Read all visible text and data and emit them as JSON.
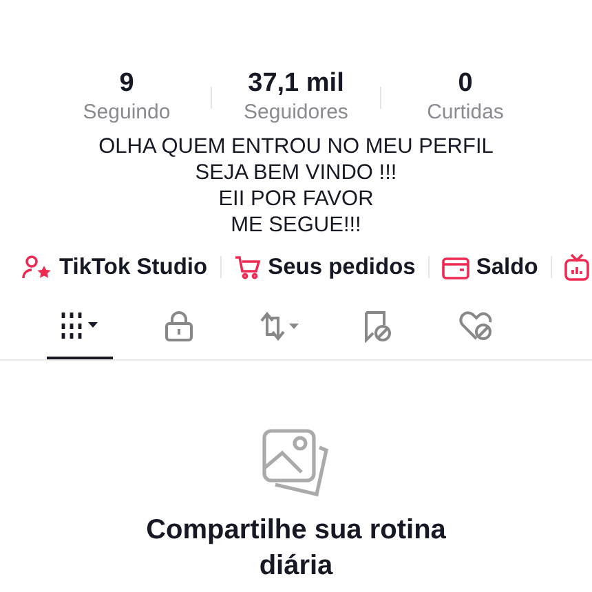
{
  "stats": [
    {
      "value": "9",
      "label": "Seguindo"
    },
    {
      "value": "37,1 mil",
      "label": "Seguidores"
    },
    {
      "value": "0",
      "label": "Curtidas"
    }
  ],
  "bio": [
    "OLHA QUEM ENTROU NO MEU PERFIL",
    "SEJA BEM VINDO !!!",
    "EII POR FAVOR",
    "ME SEGUE!!!"
  ],
  "links": [
    {
      "kind": "studio",
      "label": "TikTok Studio"
    },
    {
      "kind": "orders",
      "label": "Seus pedidos"
    },
    {
      "kind": "wallet",
      "label": "Saldo"
    },
    {
      "kind": "live"
    }
  ],
  "tabs": [
    {
      "kind": "grid",
      "selected": true
    },
    {
      "kind": "lock",
      "selected": false
    },
    {
      "kind": "repost",
      "selected": false
    },
    {
      "kind": "bookmark",
      "selected": false
    },
    {
      "kind": "liked",
      "selected": false
    }
  ],
  "empty": {
    "title": "Compartilhe sua rotina diária"
  }
}
